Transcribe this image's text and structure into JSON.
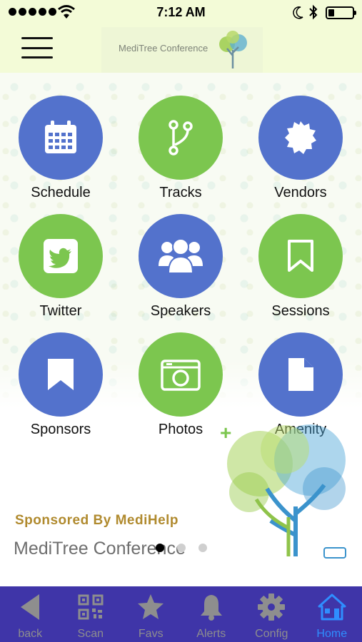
{
  "status_bar": {
    "time": "7:12 AM",
    "icons": [
      "signal-dots-icon",
      "wifi-icon",
      "moon-icon",
      "bluetooth-icon",
      "battery-icon"
    ]
  },
  "header": {
    "logo_text": "MediTree Conference",
    "icons": [
      "hamburger-menu-icon",
      "tree-logo-icon"
    ]
  },
  "grid": {
    "items": [
      {
        "label": "Schedule",
        "icon": "calendar-icon",
        "color": "#5372cc"
      },
      {
        "label": "Tracks",
        "icon": "branch-icon",
        "color": "#7cc64f"
      },
      {
        "label": "Vendors",
        "icon": "badge-icon",
        "color": "#5372cc"
      },
      {
        "label": "Twitter",
        "icon": "twitter-icon",
        "color": "#7cc64f"
      },
      {
        "label": "Speakers",
        "icon": "group-icon",
        "color": "#5372cc"
      },
      {
        "label": "Sessions",
        "icon": "bookmark-outline-icon",
        "color": "#7cc64f"
      },
      {
        "label": "Sponsors",
        "icon": "bookmark-icon",
        "color": "#5372cc"
      },
      {
        "label": "Photos",
        "icon": "camera-icon",
        "color": "#7cc64f"
      },
      {
        "label": "Amenity",
        "icon": "document-icon",
        "color": "#5372cc"
      }
    ]
  },
  "sponsor": {
    "sponsored_by": "Sponsored By MediHelp",
    "name": "MediTree Conference",
    "page_count": 3,
    "active_page": 1
  },
  "tab_bar": {
    "items": [
      {
        "label": "back",
        "icon": "back-arrow-icon",
        "active": false
      },
      {
        "label": "Scan",
        "icon": "qr-code-icon",
        "active": false
      },
      {
        "label": "Favs",
        "icon": "star-icon",
        "active": false
      },
      {
        "label": "Alerts",
        "icon": "bell-icon",
        "active": false
      },
      {
        "label": "Config",
        "icon": "gear-icon",
        "active": false
      },
      {
        "label": "Home",
        "icon": "home-icon",
        "active": true
      }
    ],
    "colors": {
      "background": "#3f35a8",
      "inactive": "#8e8e8e",
      "active": "#2f8eff"
    }
  }
}
